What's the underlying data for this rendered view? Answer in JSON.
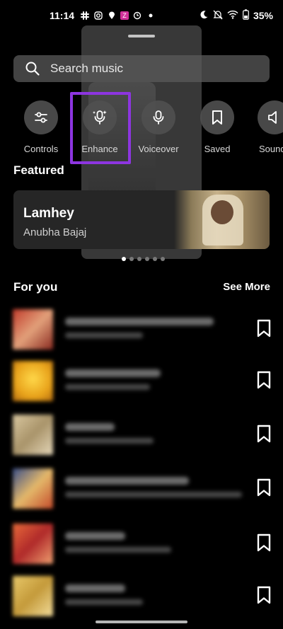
{
  "status_bar": {
    "time": "11:14",
    "battery": "35%",
    "icons": [
      "slack-icon",
      "instagram-icon",
      "location-icon",
      "app-z-icon",
      "clock-icon",
      "dot-icon",
      "moon-icon",
      "mute-icon",
      "wifi-icon",
      "battery-icon"
    ]
  },
  "search": {
    "placeholder": "Search music"
  },
  "tools": [
    {
      "label": "Controls",
      "icon": "sliders-icon"
    },
    {
      "label": "Enhance",
      "icon": "sparkle-mic-icon"
    },
    {
      "label": "Voiceover",
      "icon": "mic-icon"
    },
    {
      "label": "Saved",
      "icon": "bookmark-icon"
    },
    {
      "label": "Sounds",
      "icon": "speaker-icon"
    }
  ],
  "featured": {
    "title": "Featured",
    "song": "Lamhey",
    "artist": "Anubha Bajaj",
    "active_page": 1,
    "page_count": 6
  },
  "for_you": {
    "title": "For you",
    "see_more": "See More"
  },
  "colors": {
    "background": "#000000",
    "highlight": "#8d35e0",
    "card": "#262626"
  }
}
